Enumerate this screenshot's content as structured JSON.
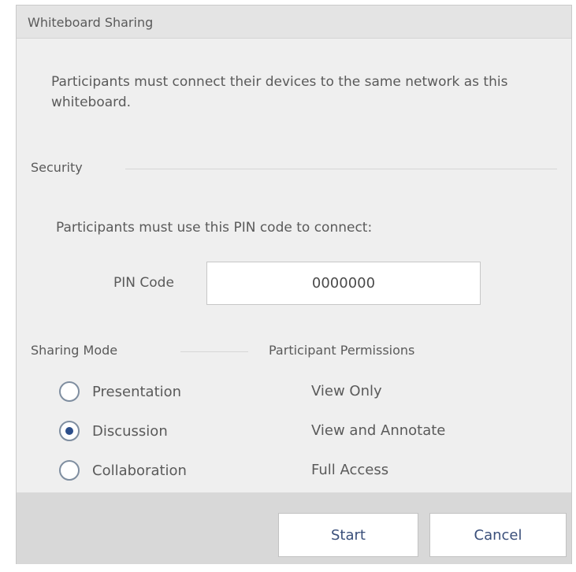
{
  "window": {
    "title": "Whiteboard Sharing"
  },
  "intro": {
    "text": "Participants must connect their devices to the same network as this whiteboard."
  },
  "security": {
    "heading": "Security",
    "instructions": "Participants must use this PIN code to connect:",
    "pin_label": "PIN Code",
    "pin_value": "0000000"
  },
  "sharing_mode": {
    "heading": "Sharing Mode",
    "options": [
      {
        "label": "Presentation",
        "selected": false
      },
      {
        "label": "Discussion",
        "selected": true
      },
      {
        "label": "Collaboration",
        "selected": false
      }
    ]
  },
  "permissions": {
    "heading": "Participant Permissions",
    "items": [
      "View Only",
      "View and Annotate",
      "Full Access"
    ]
  },
  "buttons": {
    "start": "Start",
    "cancel": "Cancel"
  },
  "colors": {
    "accent": "#2c4e8a",
    "button_text": "#3a4f7a",
    "dialog_bg": "#efefef",
    "footer_bg": "#d8d8d8"
  }
}
